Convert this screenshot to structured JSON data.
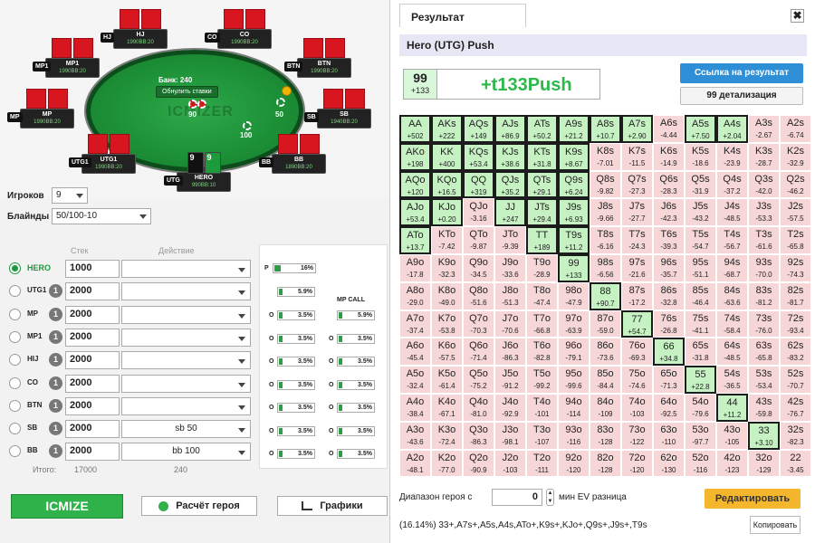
{
  "table": {
    "bank": "Банк: 240",
    "reset_bets": "Обнулить ставки",
    "watermark": "ICMIZER",
    "bet_sb": "50",
    "bet_bb": "100",
    "bet_center": "90",
    "seats": [
      {
        "pos": "HJ",
        "name": "HJ",
        "stack": "1990BB:20"
      },
      {
        "pos": "CO",
        "name": "CO",
        "stack": "1990BB:20"
      },
      {
        "pos": "MP1",
        "name": "MP1",
        "stack": "1990BB:20"
      },
      {
        "pos": "BTN",
        "name": "BTN",
        "stack": "1990BB:20"
      },
      {
        "pos": "MP",
        "name": "MP",
        "stack": "1990BB:20"
      },
      {
        "pos": "SB",
        "name": "SB",
        "stack": "1940BB:20"
      },
      {
        "pos": "UTG1",
        "name": "UTG1",
        "stack": "1990BB:20"
      },
      {
        "pos": "BB",
        "name": "BB",
        "stack": "1890BB:20"
      },
      {
        "pos": "UTG",
        "name": "HERO",
        "stack": "990BB:10"
      }
    ],
    "hero_cards": [
      "9",
      "9"
    ]
  },
  "form": {
    "players_label": "Игроков",
    "players_value": "9",
    "blinds_label": "Блайнды",
    "blinds_value": "50/100-10",
    "stack_header": "Стек",
    "action_header": "Действие",
    "total_label": "Итого:",
    "total_stack": "17000",
    "total_action": "240",
    "players": [
      {
        "name": "HERO",
        "badge": "",
        "stack": "1000",
        "action": ""
      },
      {
        "name": "UTG1",
        "badge": "1",
        "stack": "2000",
        "action": ""
      },
      {
        "name": "MP",
        "badge": "1",
        "stack": "2000",
        "action": ""
      },
      {
        "name": "MP1",
        "badge": "1",
        "stack": "2000",
        "action": ""
      },
      {
        "name": "HIJ",
        "badge": "1",
        "stack": "2000",
        "action": ""
      },
      {
        "name": "CO",
        "badge": "1",
        "stack": "2000",
        "action": ""
      },
      {
        "name": "BTN",
        "badge": "1",
        "stack": "2000",
        "action": ""
      },
      {
        "name": "SB",
        "badge": "1",
        "stack": "2000",
        "action": "sb 50"
      },
      {
        "name": "BB",
        "badge": "1",
        "stack": "2000",
        "action": "bb 100"
      }
    ]
  },
  "ranges": {
    "p_label": "P",
    "p_value": "16%",
    "col1": [
      "5.9%",
      "3.5%",
      "3.5%",
      "3.5%",
      "3.5%",
      "3.5%",
      "3.5%",
      "3.5%"
    ],
    "col1_label": "O",
    "mp_call": "MP CALL",
    "col2": [
      "5.9%",
      "3.5%",
      "3.5%",
      "3.5%",
      "3.5%",
      "3.5%",
      "3.5%"
    ]
  },
  "buttons": {
    "icmize": "ICMIZE",
    "hero_calc": "Расчёт героя",
    "charts": "Графики"
  },
  "result": {
    "tab_title": "Результат",
    "close": "✖",
    "subtitle": "Hero (UTG) Push",
    "hand": "99",
    "hand_ev": "+133",
    "big_ev": "+t133Push",
    "link_btn": "Ссылка на результат",
    "detail_btn": "99 детализация",
    "range_label": "Диапазон героя с",
    "min_ev": "0",
    "min_ev_label": "мин EV разница",
    "edit_btn": "Редактировать",
    "summary": "(16.14%) 33+,A7s+,A5s,A4s,ATo+,K9s+,KJo+,Q9s+,J9s+,T9s",
    "copy_btn": "Копировать"
  },
  "colors": {
    "positive": "#c6f2c3",
    "negative": "#f6d6d6",
    "accent": "#2fb24a"
  },
  "grid": [
    [
      [
        "AA",
        "+502",
        1
      ],
      [
        "AKs",
        "+222",
        1
      ],
      [
        "AQs",
        "+149",
        1
      ],
      [
        "AJs",
        "+86.9",
        1
      ],
      [
        "ATs",
        "+50.2",
        1
      ],
      [
        "A9s",
        "+21.2",
        1
      ],
      [
        "A8s",
        "+10.7",
        1
      ],
      [
        "A7s",
        "+2.90",
        1
      ],
      [
        "A6s",
        "-4.44",
        0
      ],
      [
        "A5s",
        "+7.50",
        1
      ],
      [
        "A4s",
        "+2.04",
        1
      ],
      [
        "A3s",
        "-2.67",
        0
      ],
      [
        "A2s",
        "-6.74",
        0
      ]
    ],
    [
      [
        "AKo",
        "+198",
        1
      ],
      [
        "KK",
        "+400",
        1
      ],
      [
        "KQs",
        "+53.4",
        1
      ],
      [
        "KJs",
        "+38.6",
        1
      ],
      [
        "KTs",
        "+31.8",
        1
      ],
      [
        "K9s",
        "+8.67",
        1
      ],
      [
        "K8s",
        "-7.01",
        0
      ],
      [
        "K7s",
        "-11.5",
        0
      ],
      [
        "K6s",
        "-14.9",
        0
      ],
      [
        "K5s",
        "-18.6",
        0
      ],
      [
        "K4s",
        "-23.9",
        0
      ],
      [
        "K3s",
        "-28.7",
        0
      ],
      [
        "K2s",
        "-32.9",
        0
      ]
    ],
    [
      [
        "AQo",
        "+120",
        1
      ],
      [
        "KQo",
        "+16.5",
        1
      ],
      [
        "QQ",
        "+319",
        1
      ],
      [
        "QJs",
        "+35.2",
        1
      ],
      [
        "QTs",
        "+29.1",
        1
      ],
      [
        "Q9s",
        "+6.24",
        1
      ],
      [
        "Q8s",
        "-9.82",
        0
      ],
      [
        "Q7s",
        "-27.3",
        0
      ],
      [
        "Q6s",
        "-28.3",
        0
      ],
      [
        "Q5s",
        "-31.9",
        0
      ],
      [
        "Q4s",
        "-37.2",
        0
      ],
      [
        "Q3s",
        "-42.0",
        0
      ],
      [
        "Q2s",
        "-46.2",
        0
      ]
    ],
    [
      [
        "AJo",
        "+53.4",
        1
      ],
      [
        "KJo",
        "+0.20",
        1
      ],
      [
        "QJo",
        "-3.16",
        0
      ],
      [
        "JJ",
        "+247",
        1
      ],
      [
        "JTs",
        "+29.4",
        1
      ],
      [
        "J9s",
        "+6.93",
        1
      ],
      [
        "J8s",
        "-9.66",
        0
      ],
      [
        "J7s",
        "-27.7",
        0
      ],
      [
        "J6s",
        "-42.3",
        0
      ],
      [
        "J5s",
        "-43.2",
        0
      ],
      [
        "J4s",
        "-48.5",
        0
      ],
      [
        "J3s",
        "-53.3",
        0
      ],
      [
        "J2s",
        "-57.5",
        0
      ]
    ],
    [
      [
        "ATo",
        "+13.7",
        1
      ],
      [
        "KTo",
        "-7.42",
        0
      ],
      [
        "QTo",
        "-9.87",
        0
      ],
      [
        "JTo",
        "-9.39",
        0
      ],
      [
        "TT",
        "+189",
        1
      ],
      [
        "T9s",
        "+11.2",
        1
      ],
      [
        "T8s",
        "-6.16",
        0
      ],
      [
        "T7s",
        "-24.3",
        0
      ],
      [
        "T6s",
        "-39.3",
        0
      ],
      [
        "T5s",
        "-54.7",
        0
      ],
      [
        "T4s",
        "-56.7",
        0
      ],
      [
        "T3s",
        "-61.6",
        0
      ],
      [
        "T2s",
        "-65.8",
        0
      ]
    ],
    [
      [
        "A9o",
        "-17.8",
        0
      ],
      [
        "K9o",
        "-32.3",
        0
      ],
      [
        "Q9o",
        "-34.5",
        0
      ],
      [
        "J9o",
        "-33.6",
        0
      ],
      [
        "T9o",
        "-28.9",
        0
      ],
      [
        "99",
        "+133",
        2
      ],
      [
        "98s",
        "-6.56",
        0
      ],
      [
        "97s",
        "-21.6",
        0
      ],
      [
        "96s",
        "-35.7",
        0
      ],
      [
        "95s",
        "-51.1",
        0
      ],
      [
        "94s",
        "-68.7",
        0
      ],
      [
        "93s",
        "-70.0",
        0
      ],
      [
        "92s",
        "-74.3",
        0
      ]
    ],
    [
      [
        "A8o",
        "-29.0",
        0
      ],
      [
        "K8o",
        "-49.0",
        0
      ],
      [
        "Q8o",
        "-51.6",
        0
      ],
      [
        "J8o",
        "-51.3",
        0
      ],
      [
        "T8o",
        "-47.4",
        0
      ],
      [
        "98o",
        "-47.9",
        0
      ],
      [
        "88",
        "+90.7",
        2
      ],
      [
        "87s",
        "-17.2",
        0
      ],
      [
        "86s",
        "-32.8",
        0
      ],
      [
        "85s",
        "-46.4",
        0
      ],
      [
        "84s",
        "-63.6",
        0
      ],
      [
        "83s",
        "-81.2",
        0
      ],
      [
        "82s",
        "-81.7",
        0
      ]
    ],
    [
      [
        "A7o",
        "-37.4",
        0
      ],
      [
        "K7o",
        "-53.8",
        0
      ],
      [
        "Q7o",
        "-70.3",
        0
      ],
      [
        "J7o",
        "-70.6",
        0
      ],
      [
        "T7o",
        "-66.8",
        0
      ],
      [
        "97o",
        "-63.9",
        0
      ],
      [
        "87o",
        "-59.0",
        0
      ],
      [
        "77",
        "+54.7",
        2
      ],
      [
        "76s",
        "-26.8",
        0
      ],
      [
        "75s",
        "-41.1",
        0
      ],
      [
        "74s",
        "-58.4",
        0
      ],
      [
        "73s",
        "-76.0",
        0
      ],
      [
        "72s",
        "-93.4",
        0
      ]
    ],
    [
      [
        "A6o",
        "-45.4",
        0
      ],
      [
        "K6o",
        "-57.5",
        0
      ],
      [
        "Q6o",
        "-71.4",
        0
      ],
      [
        "J6o",
        "-86.3",
        0
      ],
      [
        "T6o",
        "-82.8",
        0
      ],
      [
        "96o",
        "-79.1",
        0
      ],
      [
        "86o",
        "-73.6",
        0
      ],
      [
        "76o",
        "-69.3",
        0
      ],
      [
        "66",
        "+34.8",
        2
      ],
      [
        "65s",
        "-31.8",
        0
      ],
      [
        "64s",
        "-48.5",
        0
      ],
      [
        "63s",
        "-65.8",
        0
      ],
      [
        "62s",
        "-83.2",
        0
      ]
    ],
    [
      [
        "A5o",
        "-32.4",
        0
      ],
      [
        "K5o",
        "-61.4",
        0
      ],
      [
        "Q5o",
        "-75.2",
        0
      ],
      [
        "J5o",
        "-91.2",
        0
      ],
      [
        "T5o",
        "-99.2",
        0
      ],
      [
        "95o",
        "-99.6",
        0
      ],
      [
        "85o",
        "-84.4",
        0
      ],
      [
        "75o",
        "-74.6",
        0
      ],
      [
        "65o",
        "-71.3",
        0
      ],
      [
        "55",
        "+22.8",
        2
      ],
      [
        "54s",
        "-36.5",
        0
      ],
      [
        "53s",
        "-53.4",
        0
      ],
      [
        "52s",
        "-70.7",
        0
      ]
    ],
    [
      [
        "A4o",
        "-38.4",
        0
      ],
      [
        "K4o",
        "-67.1",
        0
      ],
      [
        "Q4o",
        "-81.0",
        0
      ],
      [
        "J4o",
        "-92.9",
        0
      ],
      [
        "T4o",
        "-101",
        0
      ],
      [
        "94o",
        "-114",
        0
      ],
      [
        "84o",
        "-109",
        0
      ],
      [
        "74o",
        "-103",
        0
      ],
      [
        "64o",
        "-92.5",
        0
      ],
      [
        "54o",
        "-79.6",
        0
      ],
      [
        "44",
        "+11.2",
        2
      ],
      [
        "43s",
        "-59.8",
        0
      ],
      [
        "42s",
        "-76.7",
        0
      ]
    ],
    [
      [
        "A3o",
        "-43.6",
        0
      ],
      [
        "K3o",
        "-72.4",
        0
      ],
      [
        "Q3o",
        "-86.3",
        0
      ],
      [
        "J3o",
        "-98.1",
        0
      ],
      [
        "T3o",
        "-107",
        0
      ],
      [
        "93o",
        "-116",
        0
      ],
      [
        "83o",
        "-128",
        0
      ],
      [
        "73o",
        "-122",
        0
      ],
      [
        "63o",
        "-110",
        0
      ],
      [
        "53o",
        "-97.7",
        0
      ],
      [
        "43o",
        "-105",
        0
      ],
      [
        "33",
        "+3.10",
        2
      ],
      [
        "32s",
        "-82.3",
        0
      ]
    ],
    [
      [
        "A2o",
        "-48.1",
        0
      ],
      [
        "K2o",
        "-77.0",
        0
      ],
      [
        "Q2o",
        "-90.9",
        0
      ],
      [
        "J2o",
        "-103",
        0
      ],
      [
        "T2o",
        "-111",
        0
      ],
      [
        "92o",
        "-120",
        0
      ],
      [
        "82o",
        "-128",
        0
      ],
      [
        "72o",
        "-120",
        0
      ],
      [
        "62o",
        "-130",
        0
      ],
      [
        "52o",
        "-116",
        0
      ],
      [
        "42o",
        "-123",
        0
      ],
      [
        "32o",
        "-129",
        0
      ],
      [
        "22",
        "-3.45",
        0
      ]
    ]
  ]
}
